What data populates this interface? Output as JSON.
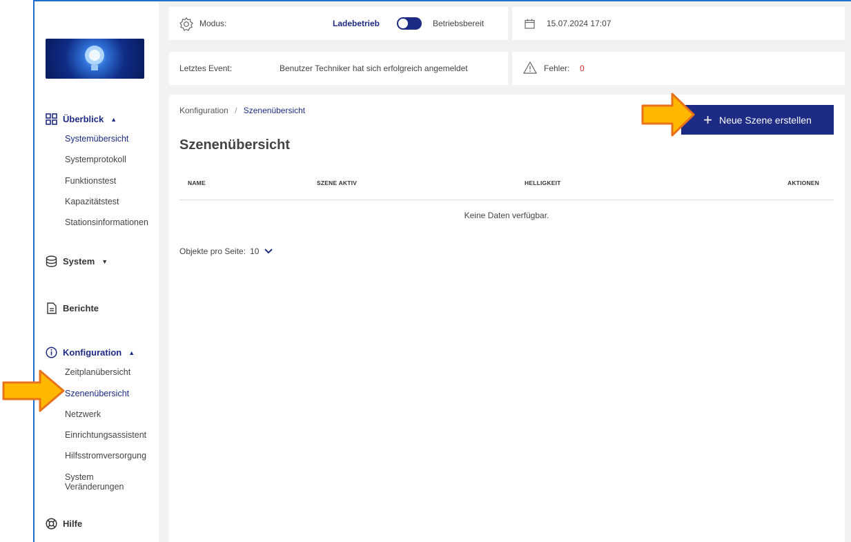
{
  "sidebar": {
    "groups": [
      {
        "label": "Überblick",
        "items": [
          "Systemübersicht",
          "Systemprotokoll",
          "Funktionstest",
          "Kapazitätstest",
          "Stationsinformationen"
        ]
      },
      {
        "label": "System"
      },
      {
        "label": "Berichte"
      },
      {
        "label": "Konfiguration",
        "items": [
          "Zeitplanübersicht",
          "Szenenübersicht",
          "Netzwerk",
          "Einrichtungsassistent",
          "Hilfsstromversorgung",
          "System Veränderungen"
        ]
      },
      {
        "label": "Hilfe"
      }
    ]
  },
  "status": {
    "mode_label": "Modus:",
    "mode_left": "Ladebetrieb",
    "mode_right": "Betriebsbereit",
    "datetime": "15.07.2024 17:07",
    "last_event_label": "Letztes Event:",
    "last_event_value": "Benutzer Techniker hat sich erfolgreich angemeldet",
    "error_label": "Fehler:",
    "error_count": "0"
  },
  "breadcrumb": {
    "root": "Konfiguration",
    "sep": "/",
    "current": "Szenenübersicht"
  },
  "page": {
    "title": "Szenenübersicht",
    "new_button": "Neue Szene erstellen",
    "columns": [
      "NAME",
      "SZENE AKTIV",
      "HELLIGKEIT",
      "AKTIONEN"
    ],
    "empty": "Keine Daten verfügbar.",
    "per_page_label": "Objekte pro Seite:",
    "per_page_value": "10"
  },
  "colors": {
    "accent": "#1d2b85",
    "error": "#d32f2f",
    "arrow_fill": "#ffb800",
    "arrow_stroke": "#e8711a"
  }
}
